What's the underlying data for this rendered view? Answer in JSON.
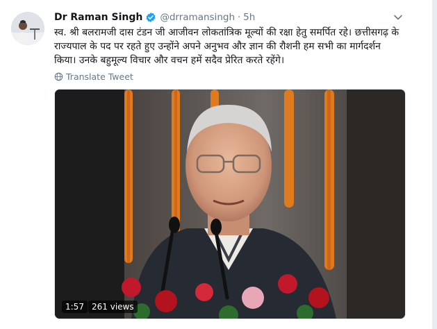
{
  "tweet": {
    "author_name": "Dr Raman Singh",
    "handle": "@drramansingh",
    "separator": "·",
    "time": "5h",
    "text": "स्व. श्री बलरामजी दास टंडन जी आजीवन लोकतांत्रिक मूल्यों की रक्षा हेतु समर्पित रहे। छत्तीसगढ़ के राज्यपाल के पद पर रहते हुए उन्होंने अपने अनुभव और ज्ञान की रौशनी हम सभी का मार्गदर्शन किया। उनके बहुमूल्य विचार और वचन हमें सदैव प्रेरित करते रहेंगे।",
    "translate_label": "Translate Tweet"
  },
  "video": {
    "duration": "1:57",
    "views": "261 views"
  },
  "colors": {
    "verified_blue": "#1da1f2",
    "secondary_text": "#657786",
    "background": "#e6ecf0"
  },
  "icons": {
    "verified": "verified-badge-icon",
    "menu": "chevron-down-icon",
    "translate": "globe-icon"
  }
}
